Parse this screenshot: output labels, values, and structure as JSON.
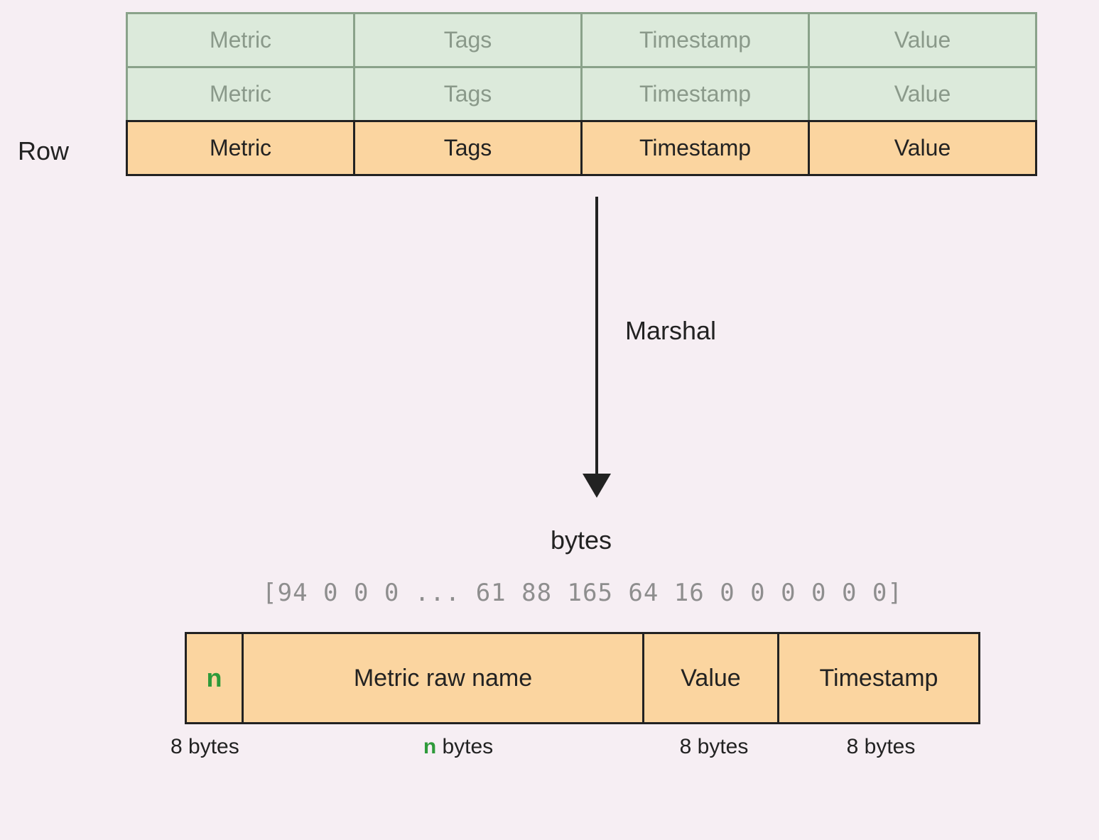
{
  "row_label": "Row",
  "row_headers": [
    "Metric",
    "Tags",
    "Timestamp",
    "Value"
  ],
  "arrow_label": "Marshal",
  "bytes_title": "bytes",
  "bytes_array": "[94 0 0 0 ... 61 88 165 64 16 0 0 0 0 0 0]",
  "byte_layout": {
    "n": "n",
    "name": "Metric raw name",
    "value": "Value",
    "timestamp": "Timestamp"
  },
  "byte_sizes": {
    "n": "8 bytes",
    "name_prefix": "",
    "name_n": "n",
    "name_suffix": " bytes",
    "value": "8 bytes",
    "timestamp": "8 bytes"
  }
}
